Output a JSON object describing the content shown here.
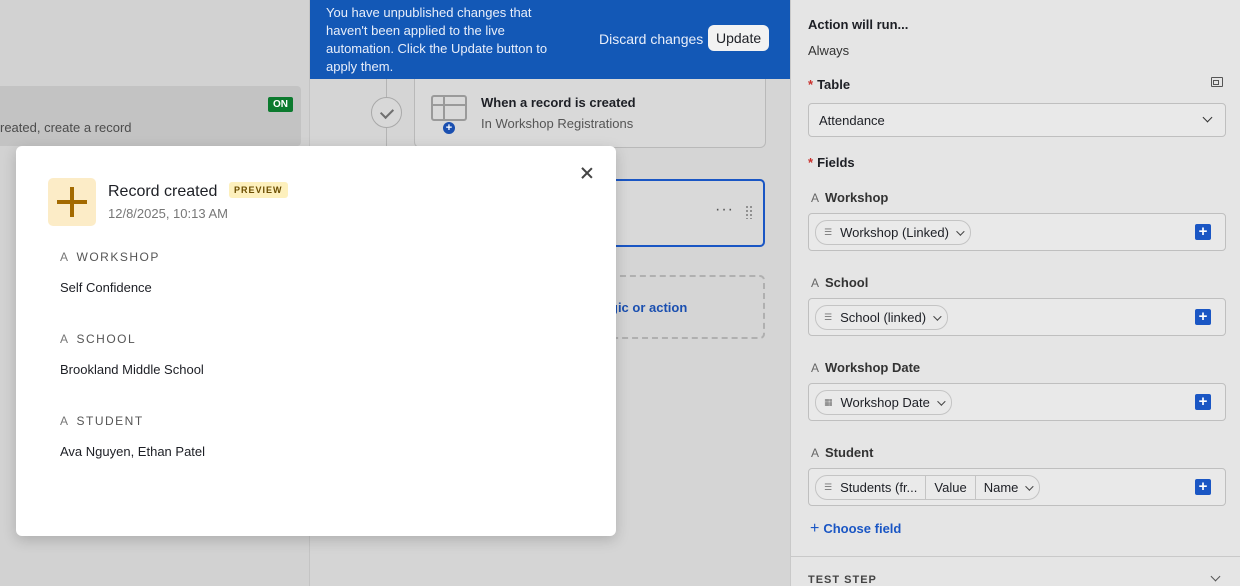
{
  "left": {
    "status_badge": "ON",
    "automation_desc": "reated, create a record"
  },
  "banner": {
    "message": "You have unpublished changes that haven't been applied to the live automation. Click the Update button to apply them.",
    "discard_label": "Discard changes",
    "update_label": "Update"
  },
  "trigger": {
    "title": "When a record is created",
    "subtitle": "In Workshop Registrations"
  },
  "add_step": {
    "label": "gic or action"
  },
  "config": {
    "action_runs_label": "Action will run...",
    "action_runs_value": "Always",
    "table_label": "Table",
    "table_value": "Attendance",
    "fields_label": "Fields",
    "fields": [
      {
        "label": "Workshop",
        "pill": "Workshop (Linked)"
      },
      {
        "label": "School",
        "pill": "School (linked)"
      },
      {
        "label": "Workshop Date",
        "pill": "Workshop Date"
      },
      {
        "label": "Student",
        "pill": "Students (fr...",
        "seg2": "Value",
        "seg3": "Name"
      }
    ],
    "choose_field": "Choose field",
    "test_step": "TEST STEP"
  },
  "modal": {
    "title": "Record created",
    "badge": "PREVIEW",
    "timestamp": "12/8/2025, 10:13 AM",
    "fields": [
      {
        "label": "WORKSHOP",
        "value": "Self Confidence"
      },
      {
        "label": "SCHOOL",
        "value": "Brookland Middle School"
      },
      {
        "label": "STUDENT",
        "value": "Ava Nguyen, Ethan Patel"
      }
    ]
  },
  "colors": {
    "banner_bg": "#1358b6",
    "accent_blue": "#1a56c4",
    "on_badge": "#0c7a2e",
    "preview_badge": "#fdf0bd",
    "plus_icon": "#a36a00"
  }
}
